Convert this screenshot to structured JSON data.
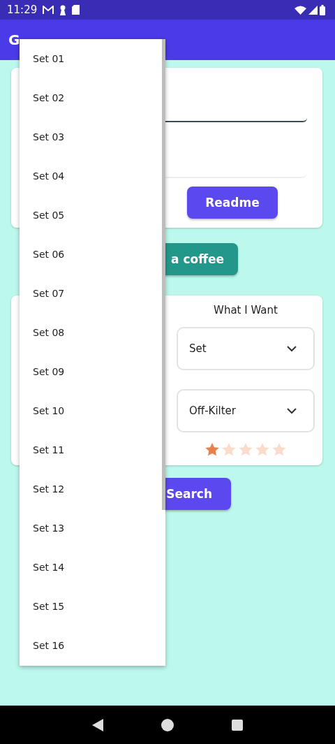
{
  "status_bar": {
    "time": "11:29"
  },
  "app_bar": {
    "title": "G"
  },
  "top_card": {
    "readme_button": "Readme"
  },
  "coffee_button": "a coffee",
  "want": {
    "title": "What I Want",
    "dropdowns": [
      {
        "value": "Set"
      },
      {
        "value": "Off-Kilter"
      }
    ],
    "stars": 1
  },
  "search_button": "Search",
  "menu": {
    "items": [
      "Set 01",
      "Set 02",
      "Set 03",
      "Set 04",
      "Set 05",
      "Set 06",
      "Set 07",
      "Set 08",
      "Set 09",
      "Set 10",
      "Set 11",
      "Set 12",
      "Set 13",
      "Set 14",
      "Set 15",
      "Set 16"
    ]
  }
}
